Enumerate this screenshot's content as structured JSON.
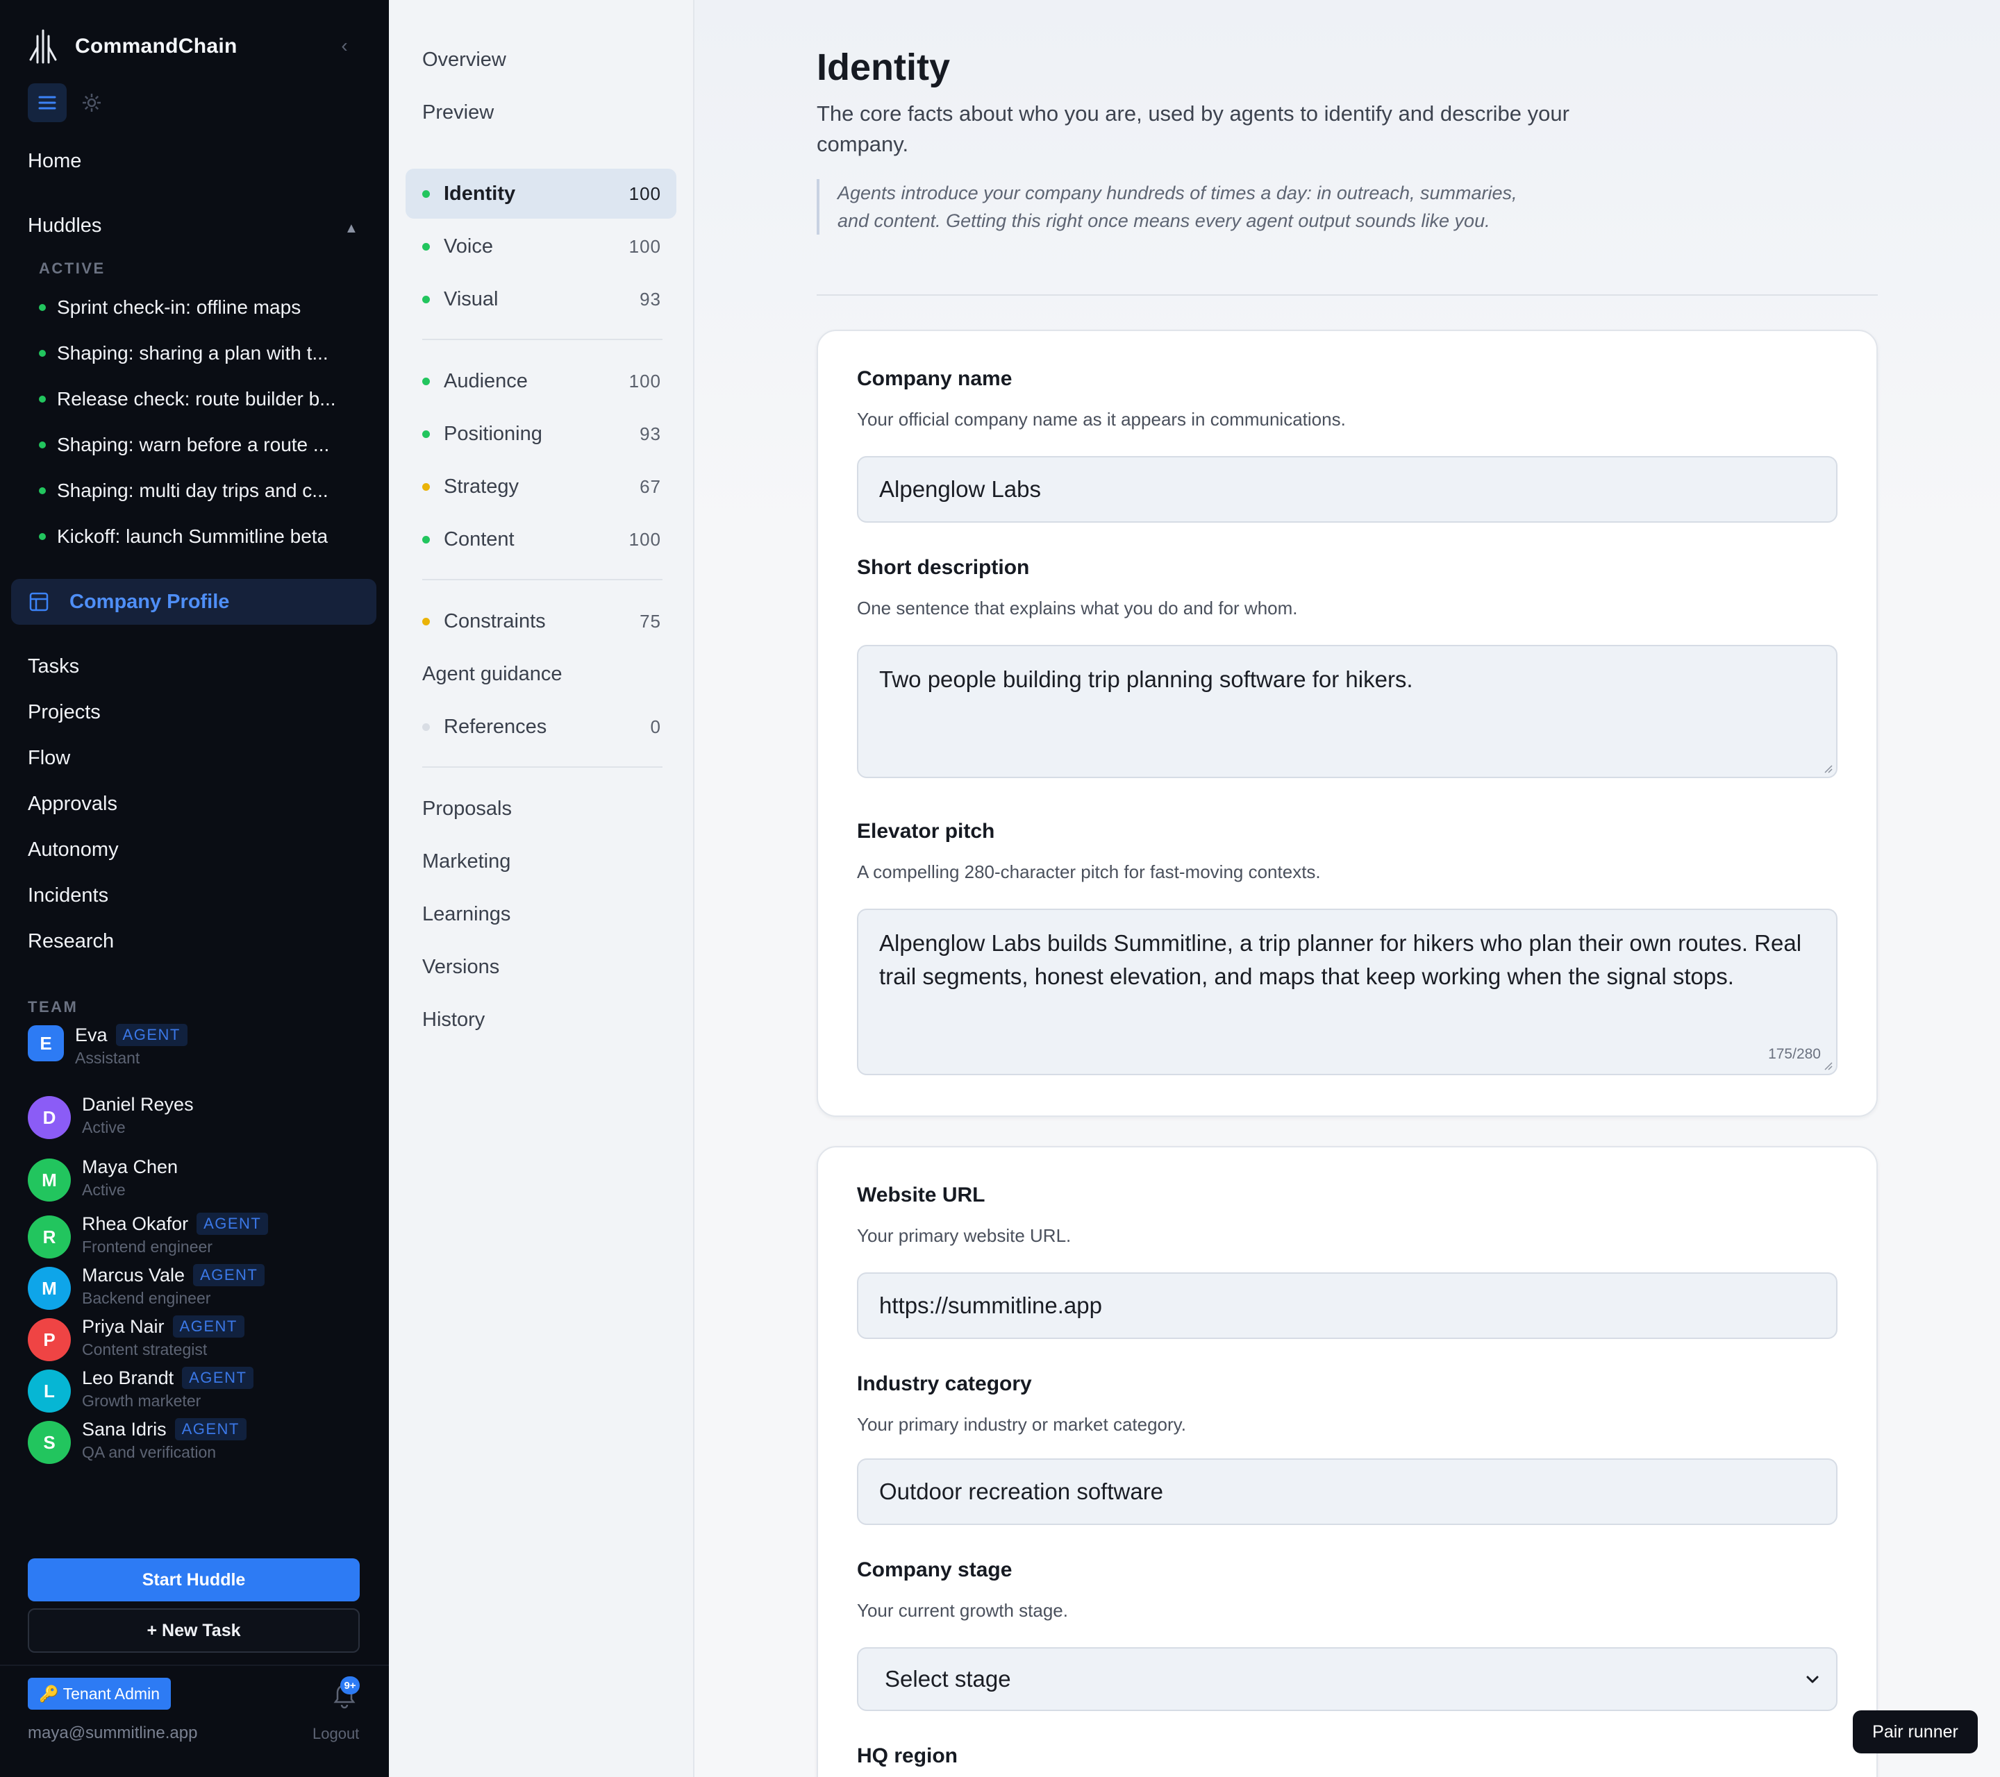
{
  "app": {
    "name": "CommandChain"
  },
  "sidebar": {
    "home": "Home",
    "huddles": {
      "title": "Huddles",
      "active_label": "ACTIVE",
      "items": [
        "Sprint check-in: offline maps",
        "Shaping: sharing a plan with t...",
        "Release check: route builder b...",
        "Shaping: warn before a route ...",
        "Shaping: multi day trips and c...",
        "Kickoff: launch Summitline beta"
      ]
    },
    "company_profile": "Company Profile",
    "nav": [
      "Tasks",
      "Projects",
      "Flow",
      "Approvals",
      "Autonomy",
      "Incidents",
      "Research"
    ],
    "team": {
      "label": "TEAM",
      "members": [
        {
          "initial": "E",
          "name": "Eva",
          "agent": "AGENT",
          "role": "Assistant",
          "color": "#2d7bf4"
        },
        {
          "initial": "D",
          "name": "Daniel Reyes",
          "agent": "",
          "role": "Active",
          "color": "#8b5cf6"
        },
        {
          "initial": "M",
          "name": "Maya Chen",
          "agent": "",
          "role": "Active",
          "color": "#22c55e"
        },
        {
          "initial": "R",
          "name": "Rhea Okafor",
          "agent": "AGENT",
          "role": "Frontend engineer",
          "color": "#22c55e"
        },
        {
          "initial": "M",
          "name": "Marcus Vale",
          "agent": "AGENT",
          "role": "Backend engineer",
          "color": "#0ea5e9"
        },
        {
          "initial": "P",
          "name": "Priya Nair",
          "agent": "AGENT",
          "role": "Content strategist",
          "color": "#ef4444"
        },
        {
          "initial": "L",
          "name": "Leo Brandt",
          "agent": "AGENT",
          "role": "Growth marketer",
          "color": "#06b6d4"
        },
        {
          "initial": "S",
          "name": "Sana Idris",
          "agent": "AGENT",
          "role": "QA and verification",
          "color": "#22c55e"
        }
      ]
    },
    "start_huddle": "Start Huddle",
    "new_task": "+ New Task",
    "tenant_admin": "🔑 Tenant Admin",
    "notifications_badge": "9+",
    "user_email": "maya@summitline.app",
    "logout": "Logout"
  },
  "section_nav": {
    "overview": "Overview",
    "preview": "Preview",
    "group1": [
      {
        "label": "Identity",
        "score": "100",
        "dot": "#22c55e",
        "active": true
      },
      {
        "label": "Voice",
        "score": "100",
        "dot": "#22c55e"
      },
      {
        "label": "Visual",
        "score": "93",
        "dot": "#22c55e"
      }
    ],
    "group2": [
      {
        "label": "Audience",
        "score": "100",
        "dot": "#22c55e"
      },
      {
        "label": "Positioning",
        "score": "93",
        "dot": "#22c55e"
      },
      {
        "label": "Strategy",
        "score": "67",
        "dot": "#eab308"
      },
      {
        "label": "Content",
        "score": "100",
        "dot": "#22c55e"
      }
    ],
    "constraints": {
      "label": "Constraints",
      "score": "75",
      "dot": "#eab308"
    },
    "agent_guidance": "Agent guidance",
    "references": {
      "label": "References",
      "score": "0",
      "dot": "#d9dde4"
    },
    "group4": [
      "Proposals",
      "Marketing",
      "Learnings",
      "Versions",
      "History"
    ]
  },
  "main": {
    "title": "Identity",
    "subtitle": "The core facts about who you are, used by agents to identify and describe your company.",
    "quote": "Agents introduce your company hundreds of times a day: in outreach, summaries, and content. Getting this right once means every agent output sounds like you.",
    "fields": {
      "company_name": {
        "label": "Company name",
        "help": "Your official company name as it appears in communications.",
        "value": "Alpenglow Labs"
      },
      "short_description": {
        "label": "Short description",
        "help": "One sentence that explains what you do and for whom.",
        "value": "Two people building trip planning software for hikers."
      },
      "elevator_pitch": {
        "label": "Elevator pitch",
        "help": "A compelling 280-character pitch for fast-moving contexts.",
        "value": "Alpenglow Labs builds Summitline, a trip planner for hikers who plan their own routes. Real trail segments, honest elevation, and maps that keep working when the signal stops.",
        "count": "175/280"
      },
      "website_url": {
        "label": "Website URL",
        "help": "Your primary website URL.",
        "value": "https://summitline.app"
      },
      "industry": {
        "label": "Industry category",
        "help": "Your primary industry or market category.",
        "value": "Outdoor recreation software"
      },
      "stage": {
        "label": "Company stage",
        "help": "Your current growth stage.",
        "value": "Select stage"
      },
      "hq_region": {
        "label": "HQ region"
      }
    }
  },
  "pair_runner": "Pair runner",
  "colors": {
    "accent": "#2d7bf4",
    "sidebar_bg": "#0a0d14",
    "active_green": "#22c55e",
    "warn_yellow": "#eab308"
  }
}
